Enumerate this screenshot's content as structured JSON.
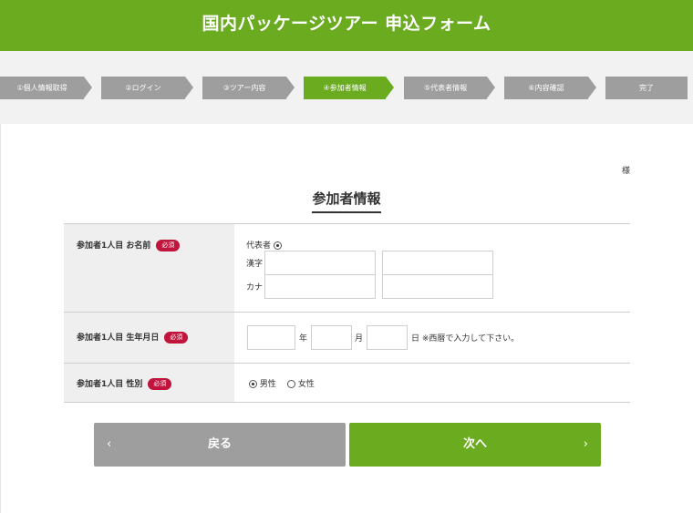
{
  "header": {
    "title": "国内パッケージツアー 申込フォーム"
  },
  "steps": [
    {
      "label": "①個人情報取得",
      "active": false
    },
    {
      "label": "②ログイン",
      "active": false
    },
    {
      "label": "③ツアー内容",
      "active": false
    },
    {
      "label": "④参加者情報",
      "active": true
    },
    {
      "label": "⑤代表者情報",
      "active": false
    },
    {
      "label": "⑥内容確認",
      "active": false
    },
    {
      "label": "完了",
      "active": false
    }
  ],
  "honorific": "様",
  "page_title": "参加者情報",
  "required_label": "必須",
  "form": {
    "name": {
      "label": "参加者1人目 お名前",
      "representative_label": "代表者",
      "representative_checked": true,
      "kanji_label": "漢字",
      "kana_label": "カナ",
      "kanji_last": "",
      "kanji_first": "",
      "kana_last": "",
      "kana_first": ""
    },
    "birthdate": {
      "label": "参加者1人目 生年月日",
      "year_unit": "年",
      "month_unit": "月",
      "day_unit": "日",
      "note": "※西暦で入力して下さい。",
      "year": "",
      "month": "",
      "day": ""
    },
    "gender": {
      "label": "参加者1人目 性別",
      "male": "男性",
      "female": "女性",
      "selected": "男性"
    }
  },
  "buttons": {
    "back": "戻る",
    "next": "次へ",
    "back_icon": "chevron-left-icon",
    "next_icon": "chevron-right-icon"
  },
  "colors": {
    "brand_green": "#6aab20",
    "step_gray": "#9e9e9e",
    "required_red": "#c0143c"
  }
}
